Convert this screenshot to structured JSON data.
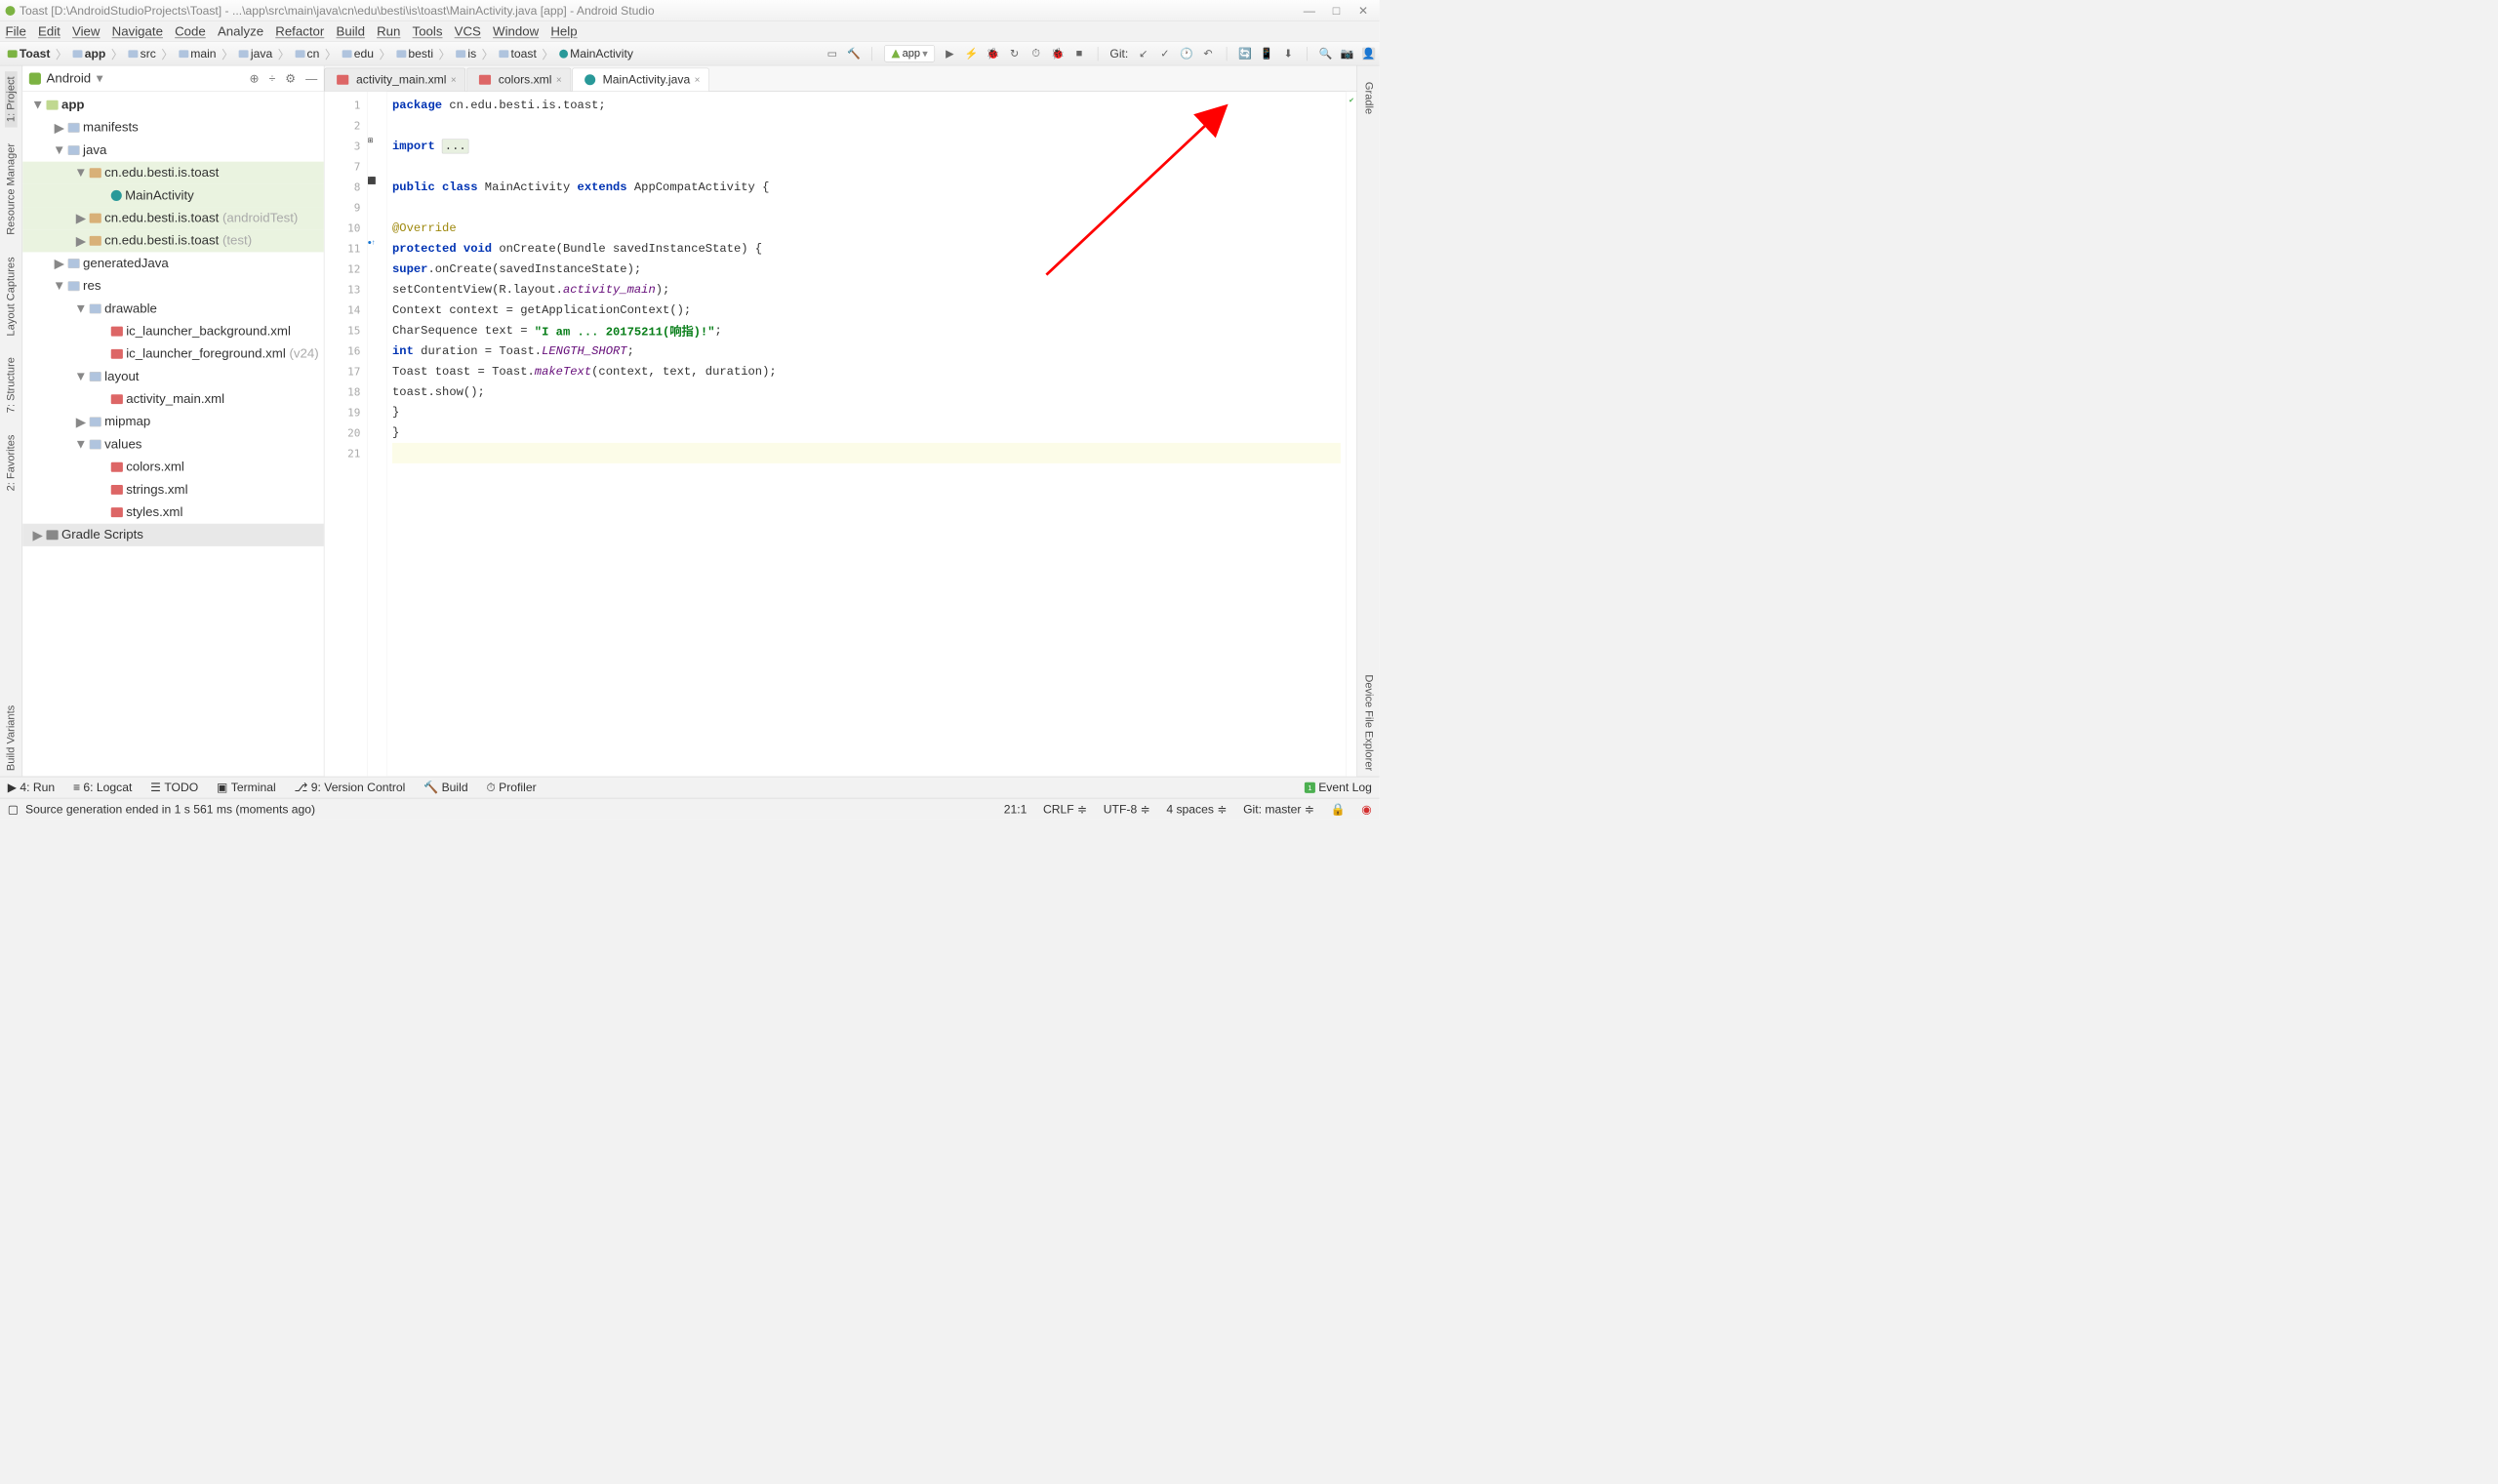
{
  "title": "Toast [D:\\AndroidStudioProjects\\Toast] - ...\\app\\src\\main\\java\\cn\\edu\\besti\\is\\toast\\MainActivity.java [app] - Android Studio",
  "menu": [
    "File",
    "Edit",
    "View",
    "Navigate",
    "Code",
    "Analyze",
    "Refactor",
    "Build",
    "Run",
    "Tools",
    "VCS",
    "Window",
    "Help"
  ],
  "breadcrumb": [
    "Toast",
    "app",
    "src",
    "main",
    "java",
    "cn",
    "edu",
    "besti",
    "is",
    "toast",
    "MainActivity"
  ],
  "runConfig": "app",
  "gitLabel": "Git:",
  "projectHeader": "Android",
  "tree": {
    "app": "app",
    "manifests": "manifests",
    "java": "java",
    "pkg1": "cn.edu.besti.is.toast",
    "main": "MainActivity",
    "pkg2": "cn.edu.besti.is.toast",
    "pkg2s": "(androidTest)",
    "pkg3": "cn.edu.besti.is.toast",
    "pkg3s": "(test)",
    "gen": "generatedJava",
    "res": "res",
    "drawable": "drawable",
    "icbg": "ic_launcher_background.xml",
    "icfg": "ic_launcher_foreground.xml",
    "icfgs": "(v24)",
    "layout": "layout",
    "actm": "activity_main.xml",
    "mipmap": "mipmap",
    "values": "values",
    "colors": "colors.xml",
    "strings": "strings.xml",
    "styles": "styles.xml",
    "gradle": "Gradle Scripts"
  },
  "tabs": [
    {
      "label": "activity_main.xml",
      "icon": "xml"
    },
    {
      "label": "colors.xml",
      "icon": "xml"
    },
    {
      "label": "MainActivity.java",
      "icon": "c",
      "active": true
    }
  ],
  "code": {
    "l1_kw": "package",
    "l1_rest": " cn.edu.besti.is.toast;",
    "l3_kw": "import ",
    "l3_fold": "...",
    "l8a": "public class ",
    "l8b": "MainActivity ",
    "l8c": "extends ",
    "l8d": "AppCompatActivity {",
    "l10": "@Override",
    "l11a": "protected void ",
    "l11b": "onCreate(Bundle savedInstanceState) {",
    "l12a": "super",
    "l12b": ".onCreate(savedInstanceState);",
    "l13a": "setContentView(R.layout.",
    "l13b": "activity_main",
    "l13c": ");",
    "l14": "Context context = getApplicationContext();",
    "l15a": "CharSequence text = ",
    "l15b": "\"I am ... 20175211(响指)!\"",
    "l15c": ";",
    "l16a": "int ",
    "l16b": "duration = Toast.",
    "l16c": "LENGTH_SHORT",
    "l16d": ";",
    "l17a": "Toast toast = Toast.",
    "l17b": "makeText",
    "l17c": "(context, text, duration);",
    "l18": "toast.show();",
    "l19": "}",
    "l20": "}"
  },
  "lineNumbers": [
    "1",
    "2",
    "3",
    "7",
    "8",
    "9",
    "10",
    "11",
    "12",
    "13",
    "14",
    "15",
    "16",
    "17",
    "18",
    "19",
    "20",
    "21"
  ],
  "bottomTabs": [
    "4: Run",
    "6: Logcat",
    "TODO",
    "Terminal",
    "9: Version Control",
    "Build",
    "Profiler"
  ],
  "eventLog": "Event Log",
  "status": {
    "msg": "Source generation ended in 1 s 561 ms (moments ago)",
    "pos": "21:1",
    "sep": "CRLF",
    "enc": "UTF-8",
    "indent": "4 spaces",
    "git": "Git: master"
  },
  "leftTabs": [
    "1: Project",
    "Resource Manager",
    "Layout Captures",
    "7: Structure",
    "2: Favorites",
    "Build Variants"
  ],
  "rightTabs": [
    "Gradle",
    "Device File Explorer"
  ]
}
